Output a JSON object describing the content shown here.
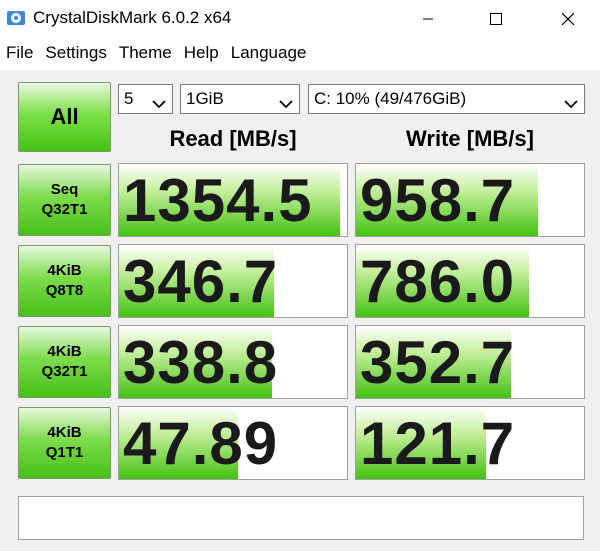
{
  "window": {
    "title": "CrystalDiskMark 6.0.2 x64"
  },
  "menu": [
    "File",
    "Settings",
    "Theme",
    "Help",
    "Language"
  ],
  "controls": {
    "all_label": "All",
    "count": "5",
    "size": "1GiB",
    "drive": "C: 10% (49/476GiB)"
  },
  "headers": {
    "read": "Read [MB/s]",
    "write": "Write [MB/s]"
  },
  "tests": [
    {
      "line1": "Seq",
      "line2": "Q32T1",
      "read": "1354.5",
      "write": "958.7",
      "read_fill": 0.97,
      "write_fill": 0.8
    },
    {
      "line1": "4KiB",
      "line2": "Q8T8",
      "read": "346.7",
      "write": "786.0",
      "read_fill": 0.68,
      "write_fill": 0.76
    },
    {
      "line1": "4KiB",
      "line2": "Q32T1",
      "read": "338.8",
      "write": "352.7",
      "read_fill": 0.67,
      "write_fill": 0.68
    },
    {
      "line1": "4KiB",
      "line2": "Q1T1",
      "read": "47.89",
      "write": "121.7",
      "read_fill": 0.52,
      "write_fill": 0.57
    }
  ],
  "comment": "",
  "colors": {
    "accent_green": "#44c114",
    "border": "#a0a0a0"
  },
  "icons": {
    "app": "crystaldiskmark-icon",
    "minimize": "minimize-icon",
    "maximize": "maximize-icon",
    "close": "close-icon",
    "dropdown": "chevron-down-icon"
  }
}
